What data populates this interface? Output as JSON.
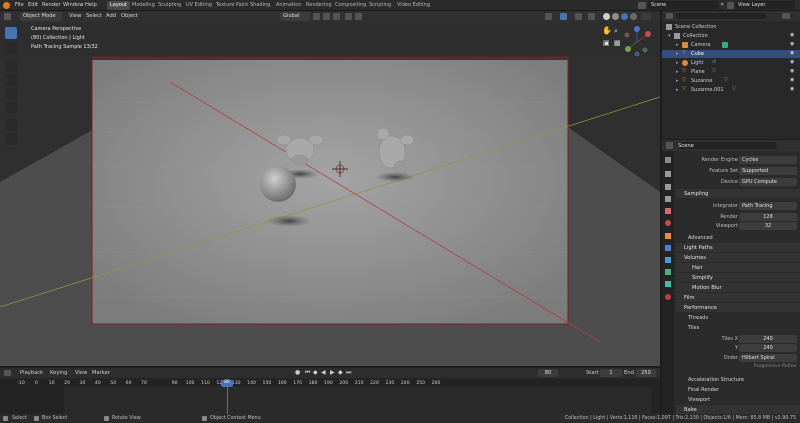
{
  "topbar": {
    "menus": [
      "File",
      "Edit",
      "Render",
      "Window",
      "Help"
    ],
    "workspaces": [
      "Layout",
      "Modeling",
      "Sculpting",
      "UV Editing",
      "Texture Paint",
      "Shading",
      "Animation",
      "Rendering",
      "Compositing",
      "Scripting",
      "Video Editing"
    ],
    "active_workspace": "Layout",
    "scene": "Scene",
    "view_layer": "View Layer"
  },
  "viewport_header": {
    "mode": "Object Mode",
    "menus": [
      "View",
      "Select",
      "Add",
      "Object"
    ],
    "orientation": "Global"
  },
  "viewport": {
    "overlay_lines": [
      "Camera Perspective",
      "(80) Collection | Light",
      "Path Tracing Sample 13/32"
    ]
  },
  "outliner": {
    "rows": [
      "Scene Collection",
      "Collection",
      "Camera",
      "Cube",
      "Light",
      "Plane",
      "Suzanne",
      "Suzanne.001"
    ],
    "selected": "Cube"
  },
  "properties": {
    "title": "Scene",
    "render_engine_label": "Render Engine",
    "render_engine": "Cycles",
    "feature_set_label": "Feature Set",
    "feature_set": "Supported",
    "device_label": "Device",
    "device": "GPU Compute",
    "sampling": "Sampling",
    "integrator_label": "Integrator",
    "integrator": "Path Tracing",
    "render_label": "Render",
    "render_samples": "128",
    "viewport_label": "Viewport",
    "viewport_samples": "32",
    "advanced": "Advanced",
    "light_paths": "Light Paths",
    "volumes": "Volumes",
    "hair": "Hair",
    "simplify": "Simplify",
    "motion_blur": "Motion Blur",
    "film": "Film",
    "performance": "Performance",
    "threads": "Threads",
    "tiles": "Tiles",
    "tiles_x_label": "Tiles X",
    "tiles_x": "240",
    "tiles_y_label": "Y",
    "tiles_y": "240",
    "order_label": "Order",
    "order": "Hilbert Spiral",
    "progressive": "Progressive Refine",
    "accel": "Acceleration Structure",
    "final_render": "Final Render",
    "viewport_sub": "Viewport",
    "bake": "Bake"
  },
  "timeline": {
    "menus": [
      "Playback",
      "Keying",
      "View",
      "Marker"
    ],
    "current_frame": "80",
    "start_label": "Start",
    "start": "1",
    "end_label": "End",
    "end": "250",
    "ticks": [
      "-10",
      "0",
      "10",
      "20",
      "30",
      "40",
      "50",
      "60",
      "70",
      "80",
      "90",
      "100",
      "110",
      "120",
      "130",
      "140",
      "150",
      "160",
      "170",
      "180",
      "190",
      "200",
      "210",
      "220",
      "230",
      "240",
      "250",
      "260"
    ],
    "current_tick": "80"
  },
  "statusbar": {
    "select": "Select",
    "box_select": "Box Select",
    "rotate_view": "Rotate View",
    "context_menu": "Object Context Menu",
    "stats": "Collection | Light | Verts:1,116 | Faces:1,097 | Tris:2,130 | Objects:1/6 | Mem: 85.8 MB | v2.90.75"
  },
  "colors": {
    "accent": "#4772b3",
    "selection": "#334d80",
    "frame": "#ff7f00"
  }
}
